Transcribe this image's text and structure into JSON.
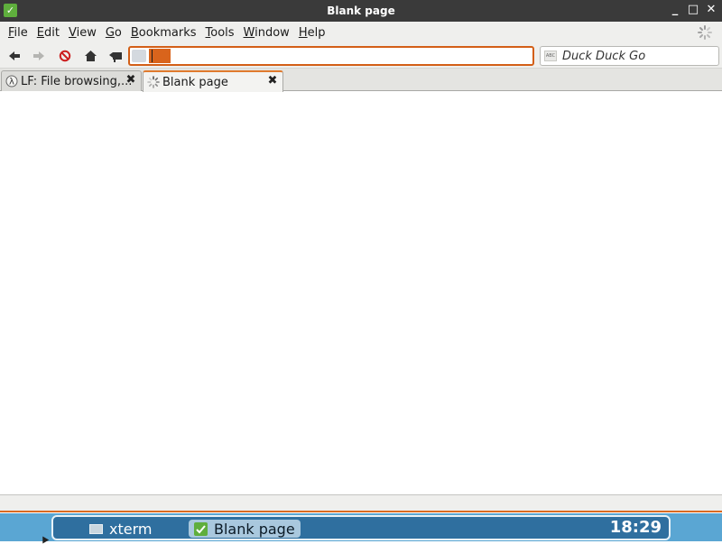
{
  "window": {
    "title": "Blank page"
  },
  "menu": [
    {
      "label": "File",
      "underline": "F",
      "rest": "ile"
    },
    {
      "label": "Edit",
      "underline": "E",
      "rest": "dit"
    },
    {
      "label": "View",
      "underline": "V",
      "rest": "iew"
    },
    {
      "label": "Go",
      "underline": "G",
      "rest": "o"
    },
    {
      "label": "Bookmarks",
      "underline": "B",
      "rest": "ookmarks"
    },
    {
      "label": "Tools",
      "underline": "T",
      "rest": "ools"
    },
    {
      "label": "Window",
      "underline": "W",
      "rest": "indow"
    },
    {
      "label": "Help",
      "underline": "H",
      "rest": "elp"
    }
  ],
  "navbar": {
    "url_value": "",
    "search_engine": "Duck Duck Go",
    "search_engine_icon_text": "ABC"
  },
  "tabs": [
    {
      "label": "LF: File browsing,...",
      "icon": "lambda-icon",
      "icon_glyph": "λ",
      "active": false
    },
    {
      "label": "Blank page",
      "icon": "loading-spinner-icon",
      "active": true
    }
  ],
  "taskbar": {
    "tasks": [
      {
        "label": "xterm",
        "icon": "terminal-icon",
        "active": false
      },
      {
        "label": "Blank page",
        "icon": "browser-icon",
        "active": true
      }
    ],
    "clock": "18:29"
  },
  "colors": {
    "accent": "#d9641c",
    "titlebar": "#3a3a3a",
    "taskbar": "#2f6f9f",
    "taskbar_bg": "#5aa6d3"
  }
}
